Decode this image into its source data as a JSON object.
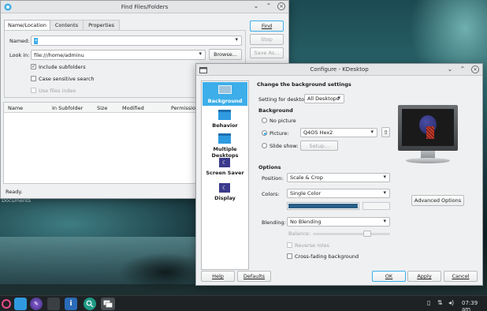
{
  "desktop": {
    "label": "Documents"
  },
  "find_window": {
    "title": "Find Files/Folders",
    "tabs": [
      "Name/Location",
      "Contents",
      "Properties"
    ],
    "named_label": "Named:",
    "named_value": "*",
    "look_in_label": "Look in:",
    "look_in_value": "file:///home/adminu",
    "browse_label": "Browse...",
    "include_subfolders": "Include subfolders",
    "case_sensitive": "Case sensitive search",
    "use_files_index": "Use files index",
    "buttons": {
      "find": "Find",
      "stop": "Stop",
      "save_as": "Save As..."
    },
    "columns": [
      "Name",
      "In Subfolder",
      "Size",
      "Modified",
      "Permission"
    ],
    "status": "Ready."
  },
  "config_window": {
    "title": "Configure - KDesktop",
    "sidebar": [
      "Background",
      "Behavior",
      "Multiple Desktops",
      "Screen Saver",
      "Display"
    ],
    "heading": "Change the background settings",
    "setting_for_label": "Setting for desktop:",
    "setting_for_value": "All Desktops",
    "background_heading": "Background",
    "no_picture": "No picture",
    "picture": "Picture:",
    "picture_value": "Q4OS Hex2",
    "slide_show": "Slide show:",
    "setup_label": "Setup...",
    "options_heading": "Options",
    "position_label": "Position:",
    "position_value": "Scale & Crop",
    "colors_label": "Colors:",
    "colors_value": "Single Color",
    "advanced_options": "Advanced Options",
    "blending_label": "Blending:",
    "blending_value": "No Blending",
    "balance_label": "Balance:",
    "reverse_roles": "Reverse roles",
    "cross_fading": "Cross-fading background",
    "footer": {
      "help": "Help",
      "defaults": "Defaults",
      "ok": "OK",
      "apply": "Apply",
      "cancel": "Cancel"
    }
  },
  "taskbar": {
    "clock": "07:39 am"
  },
  "colors": {
    "accent": "#3daee9",
    "color_swatch": "#2b5f88"
  },
  "icons": [
    "q4os-logo-icon",
    "folder-icon",
    "browser-icon",
    "terminal-icon",
    "info-icon",
    "search-icon",
    "windows-icon",
    "clipboard-icon",
    "network-icon",
    "volume-icon"
  ]
}
